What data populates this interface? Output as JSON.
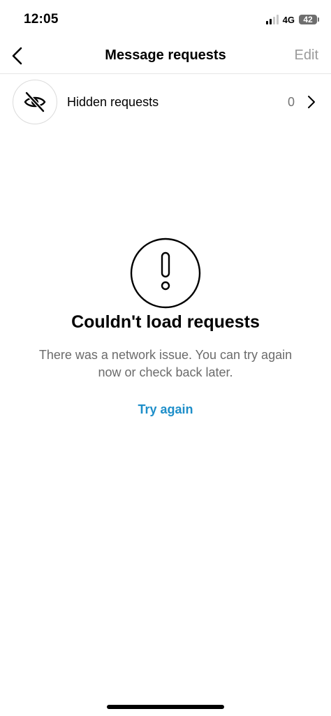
{
  "status_bar": {
    "time": "12:05",
    "network": "4G",
    "battery": "42"
  },
  "nav": {
    "back_icon": "chevron-left-icon",
    "title": "Message requests",
    "edit_label": "Edit"
  },
  "hidden_requests": {
    "icon": "eye-slash-icon",
    "label": "Hidden requests",
    "count": "0",
    "chevron_icon": "chevron-right-icon"
  },
  "error": {
    "icon": "alert-circle-icon",
    "title": "Couldn't load requests",
    "message": "There was a network issue. You can try again now or check back later.",
    "action_label": "Try again"
  },
  "colors": {
    "accent": "#1d8ec9",
    "muted_text": "#6b6b6b",
    "edit_text": "#9a9a9a"
  }
}
